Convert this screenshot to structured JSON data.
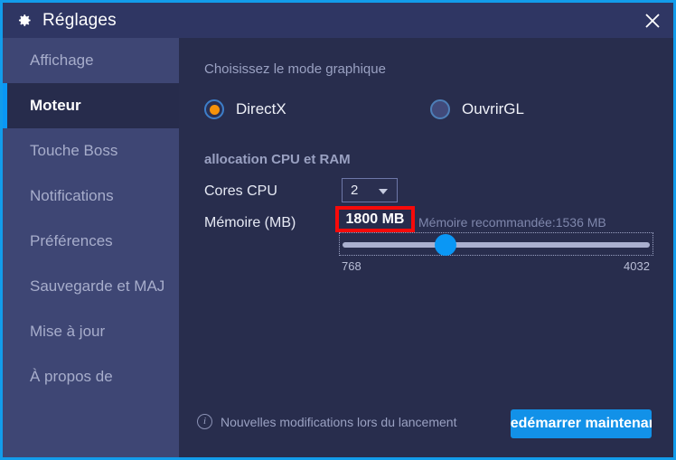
{
  "window": {
    "title": "Réglages",
    "gear_icon": "gear-icon",
    "close_icon": "close-icon",
    "accent_color": "#129ceb",
    "background": "#282d4d",
    "sidebar_background": "#3e4674"
  },
  "sidebar": {
    "items": [
      {
        "label": "Affichage",
        "active": false
      },
      {
        "label": "Moteur",
        "active": true
      },
      {
        "label": "Touche Boss",
        "active": false
      },
      {
        "label": "Notifications",
        "active": false
      },
      {
        "label": "Préférences",
        "active": false
      },
      {
        "label": "Sauvegarde et MAJ",
        "active": false
      },
      {
        "label": "Mise à jour",
        "active": false
      },
      {
        "label": "À propos de",
        "active": false
      }
    ]
  },
  "graphics": {
    "section_title": "Choisissez le mode graphique",
    "options": [
      {
        "label": "DirectX",
        "selected": true
      },
      {
        "label": "OuvrirGL",
        "selected": false
      }
    ],
    "selected_dot_color": "#f5920b"
  },
  "allocation": {
    "section_title": "allocation CPU et RAM",
    "cores_label": "Cores CPU",
    "cores_value": "2",
    "memory_label": "Mémoire (MB)",
    "memory_value": "1800 MB",
    "memory_highlight_color": "#f70a0a",
    "recommended_text": "Mémoire recommandée:1536 MB",
    "slider": {
      "min_label": "768",
      "max_label": "4032",
      "min": 768,
      "max": 4032,
      "value": 1800,
      "handle_color": "#0a97f5"
    }
  },
  "footer": {
    "info_icon": "info-icon",
    "note": "Nouvelles modifications lors du lancement",
    "restart_button": "Redémarrer maintenant",
    "restart_button_color": "#1291e8"
  }
}
